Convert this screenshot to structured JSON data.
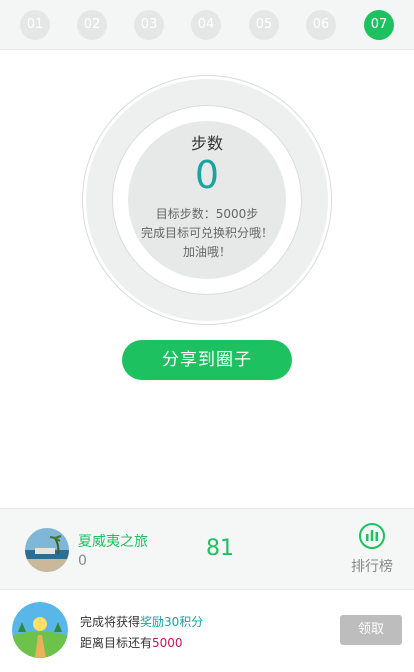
{
  "day_tabs": [
    {
      "label": "01",
      "active": false
    },
    {
      "label": "02",
      "active": false
    },
    {
      "label": "03",
      "active": false
    },
    {
      "label": "04",
      "active": false
    },
    {
      "label": "05",
      "active": false
    },
    {
      "label": "06",
      "active": false
    },
    {
      "label": "07",
      "active": true
    }
  ],
  "progress": {
    "title": "步数",
    "count": "0",
    "goal_text": "目标步数：5000步",
    "hint_text": "完成目标可兑换积分哦！",
    "cheer_text": "加油哦！"
  },
  "share_button": {
    "label": "分享到圈子"
  },
  "ranking": {
    "user_name": "夏威夷之旅",
    "user_rank": "0",
    "user_steps": "81",
    "rank_button_label": "排行榜",
    "rank_icon": "bar-chart-icon"
  },
  "reward": {
    "line1_prefix": "完成将获得",
    "line1_highlight": "奖励30积分",
    "line2_prefix": "距离目标还有",
    "line2_highlight": "5000",
    "claim_label": "领取",
    "badge_icon": "landscape-badge-icon"
  },
  "colors": {
    "accent_green": "#1ec160",
    "teal": "#1aa3a0",
    "highlight_red": "#c2185b",
    "disabled_gray": "#bdbdbd"
  }
}
